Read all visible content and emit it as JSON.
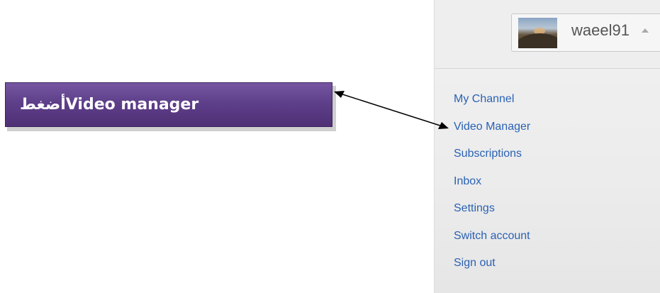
{
  "account": {
    "username": "waeel91"
  },
  "menu": {
    "items": [
      {
        "label": "My Channel"
      },
      {
        "label": "Video Manager"
      },
      {
        "label": "Subscriptions"
      },
      {
        "label": "Inbox"
      },
      {
        "label": "Settings"
      },
      {
        "label": "Switch account"
      },
      {
        "label": "Sign out"
      }
    ]
  },
  "callout": {
    "text": "أضغطVideo manager"
  },
  "colors": {
    "link": "#2a62b3",
    "callout_purple": "#5e3f8a",
    "panel": "#eeeeee"
  }
}
